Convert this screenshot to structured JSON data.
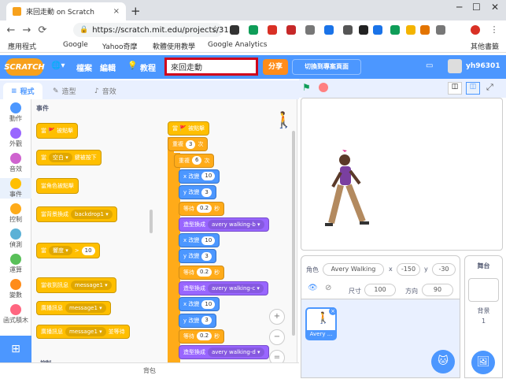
{
  "browser": {
    "tab_title": "來回走動 on Scratch",
    "tab_close": "×",
    "new_tab": "+",
    "url": "https://scratch.mit.edu/projects/31...",
    "bookmarks": [
      "應用程式",
      "Google",
      "Yahoo奇摩",
      "軟體使用教學",
      "Google Analytics",
      "其他書籤"
    ]
  },
  "menu": {
    "logo": "SCRATCH",
    "file": "檔案",
    "edit": "編輯",
    "tutorials": "教程",
    "project_title": "來回走動",
    "share": "分享",
    "see_project_page": "切換到專案頁面",
    "username": "yh96301"
  },
  "editor_tabs": {
    "code": "程式",
    "costumes": "造型",
    "sounds": "音效"
  },
  "categories": [
    {
      "label": "動作",
      "color": "#4c97ff"
    },
    {
      "label": "外觀",
      "color": "#9966ff"
    },
    {
      "label": "音效",
      "color": "#cf63cf"
    },
    {
      "label": "事件",
      "color": "#ffbf00"
    },
    {
      "label": "控制",
      "color": "#ffab19"
    },
    {
      "label": "偵測",
      "color": "#5cb1d6"
    },
    {
      "label": "運算",
      "color": "#59c059"
    },
    {
      "label": "變數",
      "color": "#ff8c1a"
    },
    {
      "label": "函式積木",
      "color": "#ff6680"
    }
  ],
  "palette": {
    "section": "事件",
    "blocks": [
      {
        "text": "當 🚩 被點擊"
      },
      {
        "text": "當",
        "dropdown": "空白",
        "suffix": "鍵被按下"
      },
      {
        "text": "當角色被點擊"
      },
      {
        "text": "當背景換成",
        "dropdown": "backdrop1"
      },
      {
        "text": "當",
        "dropdown": "響度",
        "op": ">",
        "value": "10"
      },
      {
        "text": "當收到訊息",
        "dropdown": "message1"
      },
      {
        "text": "廣播訊息",
        "dropdown": "message1"
      },
      {
        "text": "廣播訊息",
        "dropdown": "message1",
        "suffix": "並等待"
      },
      {
        "text": "控制"
      }
    ]
  },
  "script": [
    {
      "type": "hat",
      "text": "當 🚩 被點擊"
    },
    {
      "type": "repeat",
      "text": "重複",
      "value": "3",
      "suffix": "次"
    },
    {
      "type": "repeat",
      "text": "重複",
      "value": "6",
      "suffix": "次"
    },
    {
      "type": "motion",
      "text": "x 改變",
      "value": "10"
    },
    {
      "type": "motion",
      "text": "y 改變",
      "value": "3"
    },
    {
      "type": "control",
      "text": "等待",
      "value": "0.2",
      "suffix": "秒"
    },
    {
      "type": "looks",
      "text": "造型換成",
      "dropdown": "avery walking-b"
    },
    {
      "type": "motion",
      "text": "x 改變",
      "value": "10"
    },
    {
      "type": "motion",
      "text": "y 改變",
      "value": "3"
    },
    {
      "type": "control",
      "text": "等待",
      "value": "0.2",
      "suffix": "秒"
    },
    {
      "type": "looks",
      "text": "造型換成",
      "dropdown": "avery walking-c"
    },
    {
      "type": "motion",
      "text": "x 改變",
      "value": "10"
    },
    {
      "type": "motion",
      "text": "y 改變",
      "value": "3"
    },
    {
      "type": "control",
      "text": "等待",
      "value": "0.2",
      "suffix": "秒"
    },
    {
      "type": "looks",
      "text": "造型換成",
      "dropdown": "avery walking-d"
    }
  ],
  "backpack": "背包",
  "sprite_info": {
    "sprite_label": "角色",
    "sprite_name": "Avery Walking",
    "x_label": "x",
    "x": "-150",
    "y_label": "y",
    "y": "-30",
    "size_label": "尺寸",
    "size": "100",
    "direction_label": "方向",
    "direction": "90"
  },
  "sprite_thumb_label": "Avery ...",
  "stage_panel": {
    "title": "舞台",
    "backdrops_label": "背景",
    "backdrops_count": "1"
  }
}
